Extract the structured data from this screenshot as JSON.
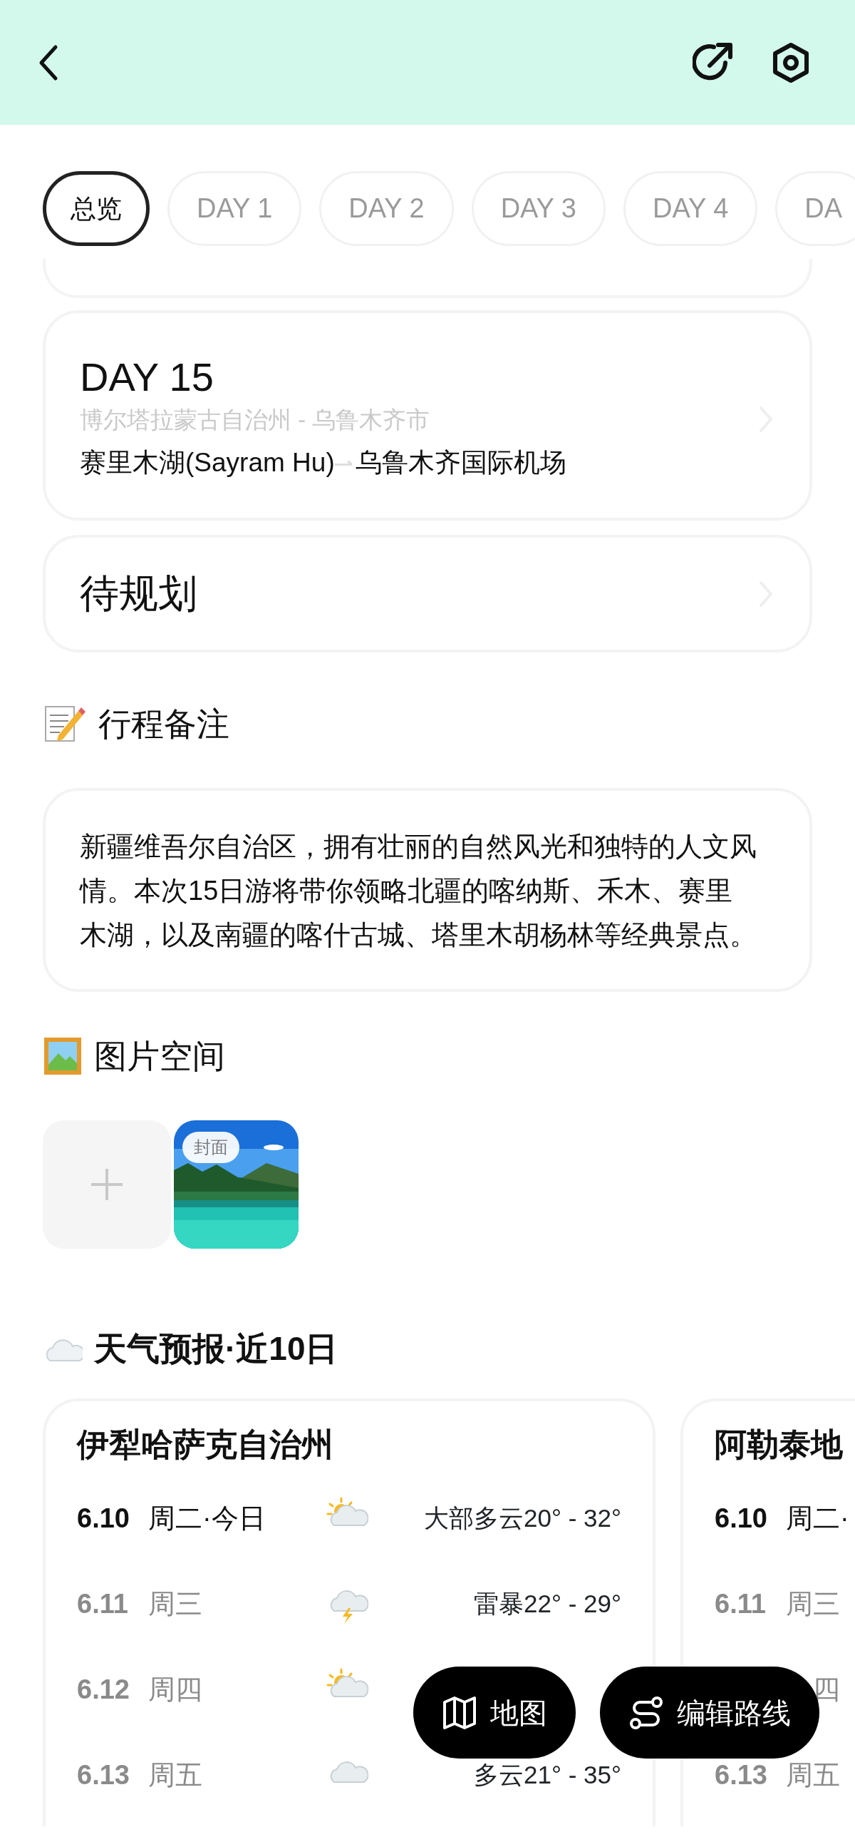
{
  "tabs": [
    {
      "label": "总览",
      "selected": true
    },
    {
      "label": "DAY 1",
      "selected": false
    },
    {
      "label": "DAY 2",
      "selected": false
    },
    {
      "label": "DAY 3",
      "selected": false
    },
    {
      "label": "DAY 4",
      "selected": false
    },
    {
      "label": "DA",
      "selected": false
    }
  ],
  "days": [
    {
      "kind": "route",
      "title": "DAY 15",
      "regions": "博尔塔拉蒙古自治州 - 乌鲁木齐市",
      "from": "赛里木湖(Sayram Hu)",
      "to": "乌鲁木齐国际机场"
    },
    {
      "kind": "pending",
      "title": "待规划"
    }
  ],
  "notes": {
    "title": "行程备注",
    "text": "新疆维吾尔自治区，拥有壮丽的自然风光和独特的人文风情。本次15日游将带你领略北疆的喀纳斯、禾木、赛里木湖，以及南疆的喀什古城、塔里木胡杨林等经典景点。"
  },
  "photos": {
    "title": "图片空间",
    "items": [
      {
        "kind": "picture",
        "badge": "封面"
      }
    ]
  },
  "weather": {
    "title": "天气预报·近10日",
    "regions": [
      {
        "name": "伊犁哈萨克自治州",
        "days": [
          {
            "date": "6.10",
            "weekday": "周二·今日",
            "today": true,
            "kind": "partly-cloudy",
            "forecast": "大部多云20° - 32°"
          },
          {
            "date": "6.11",
            "weekday": "周三",
            "today": false,
            "kind": "thunderstorm",
            "forecast": "雷暴22° - 29°"
          },
          {
            "date": "6.12",
            "weekday": "周四",
            "today": false,
            "kind": "partly-cloudy"
          },
          {
            "date": "6.13",
            "weekday": "周五",
            "today": false,
            "kind": "cloudy",
            "forecast": "多云21° - 35°"
          }
        ]
      },
      {
        "name": "阿勒泰地",
        "days": [
          {
            "date": "6.10",
            "weekday": "周二·",
            "today": true
          },
          {
            "date": "6.11",
            "weekday": "周三",
            "today": false
          },
          {
            "weekday": "四",
            "today": false
          },
          {
            "date": "6.13",
            "weekday": "周五",
            "today": false
          }
        ]
      }
    ]
  },
  "actions": [
    {
      "kind": "map",
      "label": "地图"
    },
    {
      "kind": "route",
      "label": "编辑路线"
    }
  ]
}
